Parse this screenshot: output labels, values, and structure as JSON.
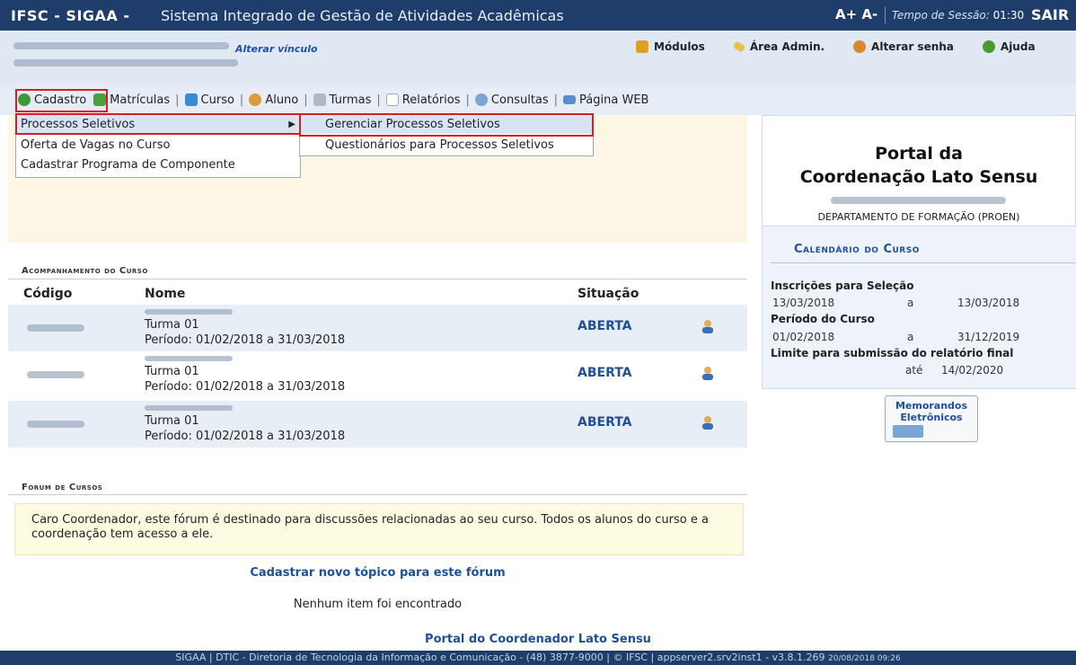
{
  "topbar": {
    "brand": "IFSC - SIGAA -",
    "subtitle": "Sistema Integrado de Gestão de Atividades Acadêmicas",
    "font_controls": "A+ A-",
    "session_label": "Tempo de Sessão:",
    "session_time": "01:30",
    "logout": "SAIR"
  },
  "userbar": {
    "alterar_vinculo": "Alterar vínculo",
    "links": [
      "Módulos",
      "Área Admin.",
      "Alterar senha",
      "Ajuda"
    ]
  },
  "menu": {
    "items": [
      "Cadastro",
      "Matrículas",
      "Curso",
      "Aluno",
      "Turmas",
      "Relatórios",
      "Consultas",
      "Página WEB"
    ],
    "cadastro_submenu": [
      "Processos Seletivos",
      "Oferta de Vagas no Curso",
      "Cadastrar Programa de Componente"
    ],
    "processos_submenu": [
      "Gerenciar Processos Seletivos",
      "Questionários para Processos Seletivos"
    ]
  },
  "portal": {
    "title_line1": "Portal da",
    "title_line2": "Coordenação Lato Sensu",
    "department": "DEPARTAMENTO DE FORMAÇÃO (PROEN)"
  },
  "calendario": {
    "title": "Calendário do Curso",
    "inscricoes_label": "Inscrições para Seleção",
    "inscricoes_inicio": "13/03/2018",
    "inscricoes_sep": "a",
    "inscricoes_fim": "13/03/2018",
    "periodo_label": "Período do Curso",
    "periodo_inicio": "01/02/2018",
    "periodo_sep": "a",
    "periodo_fim": "31/12/2019",
    "limite_label": "Limite para submissão do relatório final",
    "limite_prefix": "até",
    "limite_data": "14/02/2020"
  },
  "memorandos": {
    "line1": "Memorandos",
    "line2": "Eletrônicos"
  },
  "acompanhamento": {
    "title": "Acompanhamento do Curso",
    "columns": [
      "Código",
      "Nome",
      "Situação"
    ],
    "rows": [
      {
        "turma": "Turma 01",
        "periodo": "Período: 01/02/2018 a 31/03/2018",
        "situacao": "ABERTA"
      },
      {
        "turma": "Turma 01",
        "periodo": "Período: 01/02/2018 a 31/03/2018",
        "situacao": "ABERTA"
      },
      {
        "turma": "Turma 01",
        "periodo": "Período: 01/02/2018 a 31/03/2018",
        "situacao": "ABERTA"
      }
    ]
  },
  "forum": {
    "title": "Forum de Cursos",
    "message": "Caro Coordenador, este fórum é destinado para discussões relacionadas ao seu curso. Todos os alunos do curso e a coordenação tem acesso a ele.",
    "new_topic": "Cadastrar novo tópico para este fórum",
    "empty": "Nenhum item foi encontrado"
  },
  "footer": {
    "portal_link": "Portal do Coordenador Lato Sensu",
    "text": "SIGAA | DTIC - Diretoria de Tecnologia da Informação e Comunicação - (48) 3877-9000 | © IFSC | appserver2.srv2inst1 - v3.8.1.269",
    "timestamp": "20/08/2018 09:26"
  },
  "colors": {
    "header": "#1e3d6b",
    "highlight": "#d42020",
    "link": "#1f4f96"
  }
}
